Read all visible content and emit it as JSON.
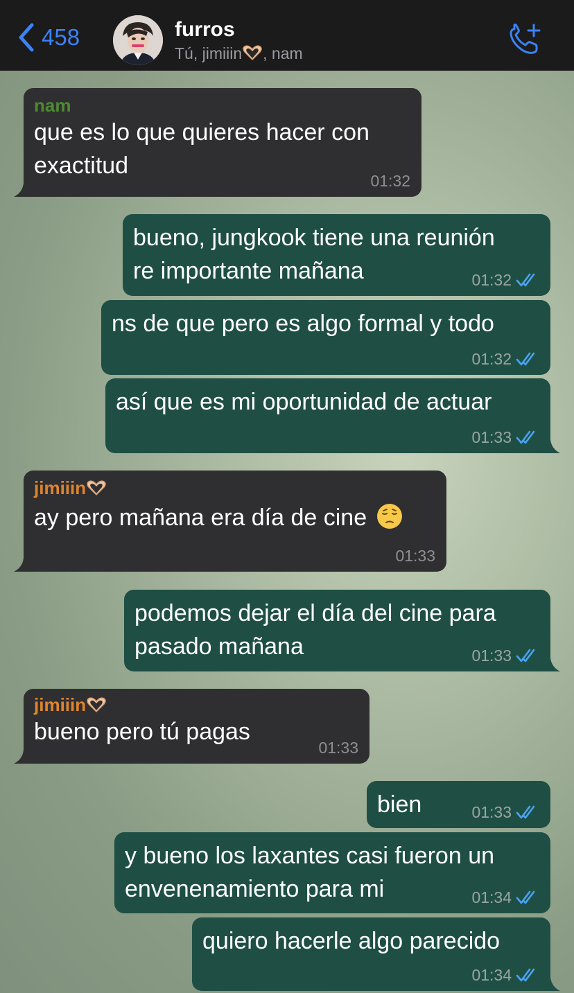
{
  "header": {
    "back_count": "458",
    "title": "furros",
    "subtitle_prefix": "Tú, jimiiin",
    "subtitle_suffix": ", nam"
  },
  "colors": {
    "accent": "#3b82f6",
    "incoming": "#2f2f31",
    "outgoing": "#1f4f44",
    "nam": "#4e8a33",
    "jimiiin": "#e0842f",
    "read_ticks": "#4aa3f2"
  },
  "icons": {
    "back": "chevron-left-icon",
    "call": "add-call-icon",
    "read": "double-check-icon",
    "heart_hands": "heart-hands-emoji",
    "pensive": "pensive-face-emoji"
  },
  "messages": [
    {
      "dir": "in",
      "sender": "nam",
      "text": "que es lo que quieres hacer con\nexactitud",
      "time": "01:32"
    },
    {
      "dir": "out",
      "text": "bueno, jungkook tiene una reunión\nre importante mañana",
      "time": "01:32"
    },
    {
      "dir": "out",
      "text": "ns de que pero es algo formal y todo",
      "time": "01:32"
    },
    {
      "dir": "out",
      "text": "así que es mi oportunidad de actuar",
      "time": "01:33"
    },
    {
      "dir": "in",
      "sender": "jimiiin",
      "text": "ay pero mañana era día de cine",
      "time": "01:33"
    },
    {
      "dir": "out",
      "text": "podemos dejar el día del cine para\npasado mañana",
      "time": "01:33"
    },
    {
      "dir": "in",
      "sender": "jimiiin",
      "text": "bueno pero tú pagas",
      "time": "01:33"
    },
    {
      "dir": "out",
      "text": "bien",
      "time": "01:33"
    },
    {
      "dir": "out",
      "text": "y bueno los laxantes casi fueron un\nenvenenamiento para mi",
      "time": "01:34"
    },
    {
      "dir": "out",
      "text": "quiero hacerle algo parecido",
      "time": "01:34"
    }
  ]
}
